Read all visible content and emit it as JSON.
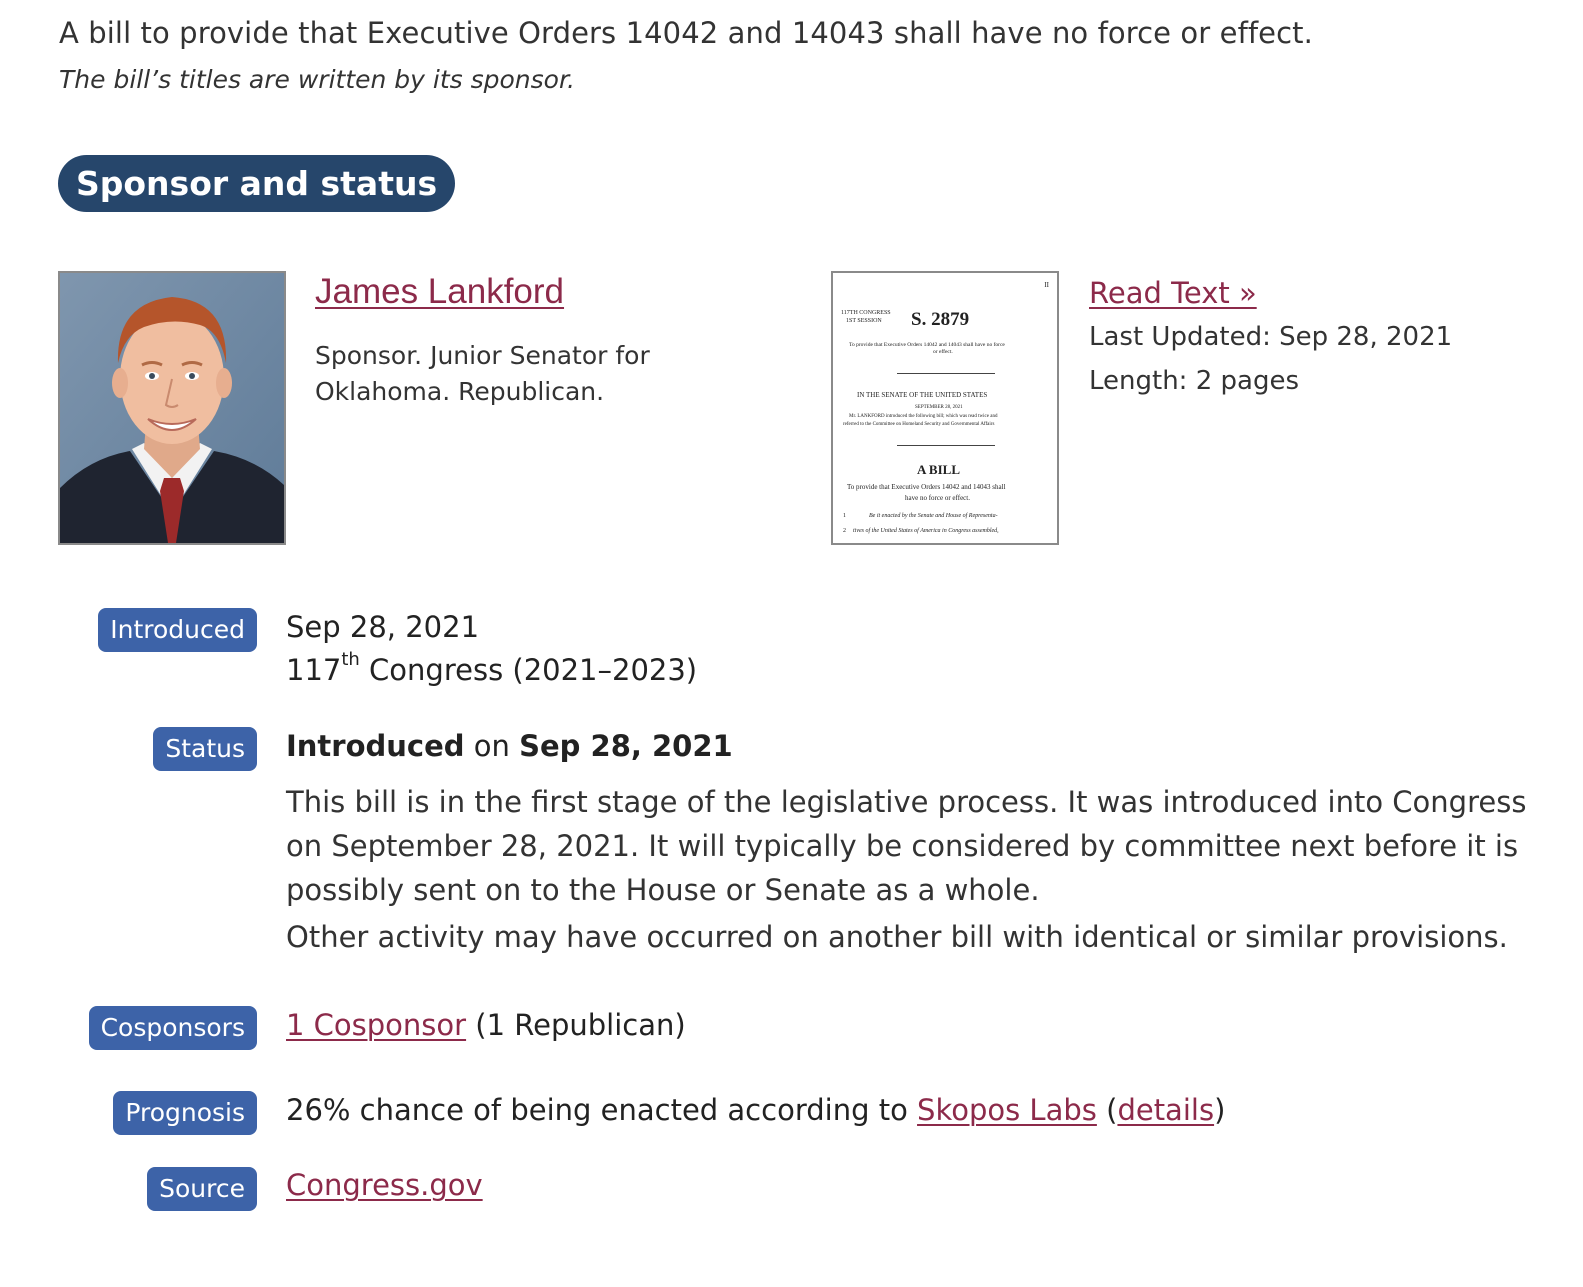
{
  "bill": {
    "title": "A bill to provide that Executive Orders 14042 and 14043 shall have no force or effect.",
    "title_note": "The bill’s titles are written by its sponsor."
  },
  "section": {
    "heading": "Sponsor and status"
  },
  "sponsor": {
    "name": "James Lankford",
    "description": "Sponsor. Junior Senator for Oklahoma. Republican."
  },
  "document": {
    "page_marker": "II",
    "congress_line1": "117TH CONGRESS",
    "congress_line2": "1ST SESSION",
    "bill_number": "S. 2879",
    "purpose_short": "To provide that Executive Orders 14042 and 14043 shall have no force",
    "purpose_short2": "or effect.",
    "chamber": "IN THE SENATE OF THE UNITED STATES",
    "date": "SEPTEMBER 28, 2021",
    "intro_line1": "Mr. LANKFORD introduced the following bill; which was read twice and",
    "intro_line2": "referred to the Committee on Homeland Security and Governmental Affairs",
    "heading": "A BILL",
    "purpose_line1": "To provide that Executive Orders 14042 and 14043 shall",
    "purpose_line2": "have no force or effect.",
    "line1_num": "1",
    "line1_text": "Be it enacted by the Senate and House of Representa-",
    "line2_num": "2",
    "line2_text": "tives of the United States of America in Congress assembled,",
    "read_text_link": "Read Text »",
    "last_updated": "Last Updated: Sep 28, 2021",
    "length": "Length: 2 pages"
  },
  "introduced": {
    "label": "Introduced",
    "date": "Sep 28, 2021",
    "congress_num": "117",
    "congress_suffix": "th",
    "congress_rest": " Congress (2021–2023)"
  },
  "status": {
    "label": "Status",
    "state": "Introduced",
    "on": " on ",
    "date": "Sep 28, 2021",
    "description": "This bill is in the first stage of the legislative process. It was introduced into Congress on September 28, 2021. It will typically be considered by committee next before it is possibly sent on to the House or Senate as a whole.",
    "other": "Other activity may have occurred on another bill with identical or similar provisions."
  },
  "cosponsors": {
    "label": "Cosponsors",
    "link": "1 Cosponsor",
    "detail": " (1 Republican)"
  },
  "prognosis": {
    "label": "Prognosis",
    "text": "26% chance of being enacted according to ",
    "link": "Skopos Labs",
    "paren_open": " (",
    "details_link": "details",
    "paren_close": ")"
  },
  "source": {
    "label": "Source",
    "link": "Congress.gov"
  }
}
